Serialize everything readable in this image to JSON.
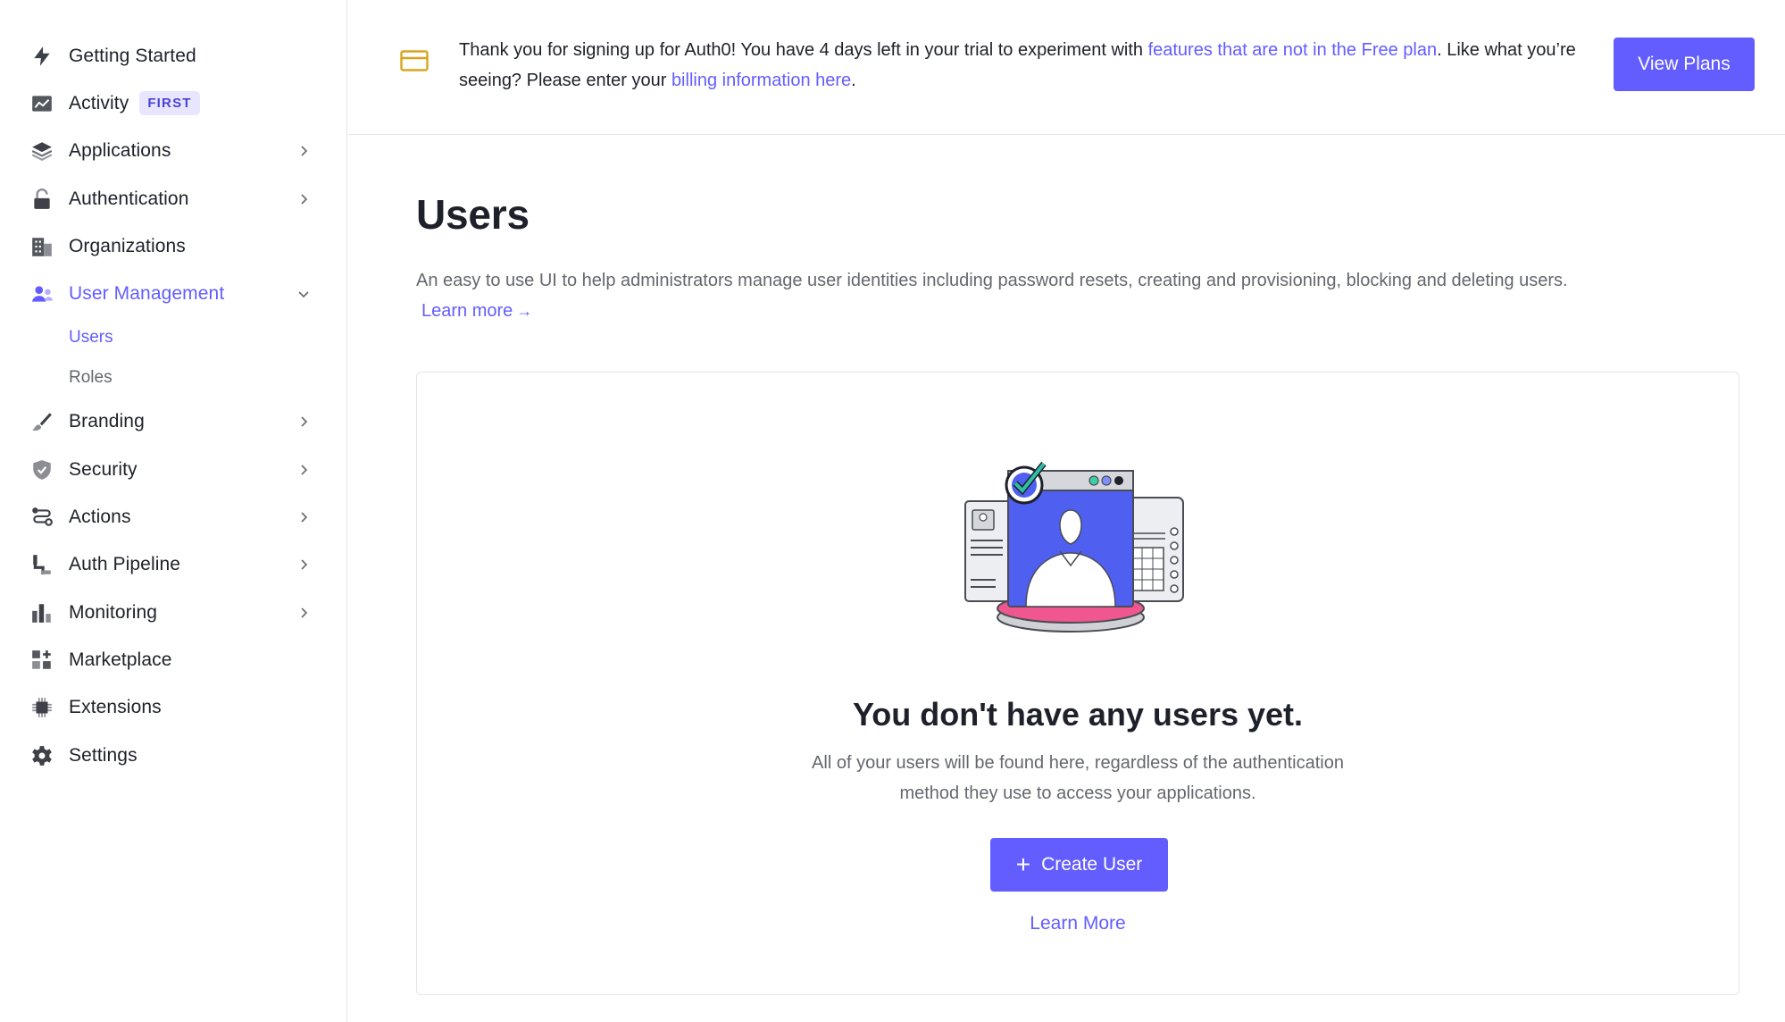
{
  "sidebar": {
    "items": [
      {
        "label": "Getting Started",
        "icon": "lightning-icon"
      },
      {
        "label": "Activity",
        "icon": "trending-icon",
        "badge": "FIRST"
      },
      {
        "label": "Applications",
        "icon": "layers-icon"
      },
      {
        "label": "Authentication",
        "icon": "lock-icon"
      },
      {
        "label": "Organizations",
        "icon": "building-icon"
      },
      {
        "label": "User Management",
        "icon": "users-icon"
      },
      {
        "label": "Branding",
        "icon": "brush-icon"
      },
      {
        "label": "Security",
        "icon": "shield-icon"
      },
      {
        "label": "Actions",
        "icon": "flow-icon"
      },
      {
        "label": "Auth Pipeline",
        "icon": "pipeline-icon"
      },
      {
        "label": "Monitoring",
        "icon": "bar-chart-icon"
      },
      {
        "label": "Marketplace",
        "icon": "grid-plus-icon"
      },
      {
        "label": "Extensions",
        "icon": "chip-icon"
      },
      {
        "label": "Settings",
        "icon": "gear-icon"
      }
    ],
    "sub_items": {
      "users": "Users",
      "roles": "Roles"
    }
  },
  "banner": {
    "text_before": "Thank you for signing up for Auth0! You have 4 days left in your trial to experiment with ",
    "link1": "features that are not in the Free plan",
    "text_middle": ". Like what you’re seeing? Please enter your ",
    "link2": "billing information here",
    "text_after": ".",
    "button": "View Plans"
  },
  "page": {
    "title": "Users",
    "description": "An easy to use UI to help administrators manage user identities including password resets, creating and provisioning, blocking and deleting users.",
    "learn_more": "Learn more",
    "learn_more_arrow": "→"
  },
  "empty_state": {
    "title": "You don't have any users yet.",
    "desc_line1": "All of your users will be found here, regardless of the authentication",
    "desc_line2": "method they use to access your applications.",
    "button": "Create User",
    "button_icon": "+",
    "learn_more": "Learn More"
  },
  "colors": {
    "accent": "#635dff",
    "text": "#1e212a",
    "muted": "#65676e",
    "border": "#e3e5e8",
    "card_icon": "#d9a520"
  }
}
